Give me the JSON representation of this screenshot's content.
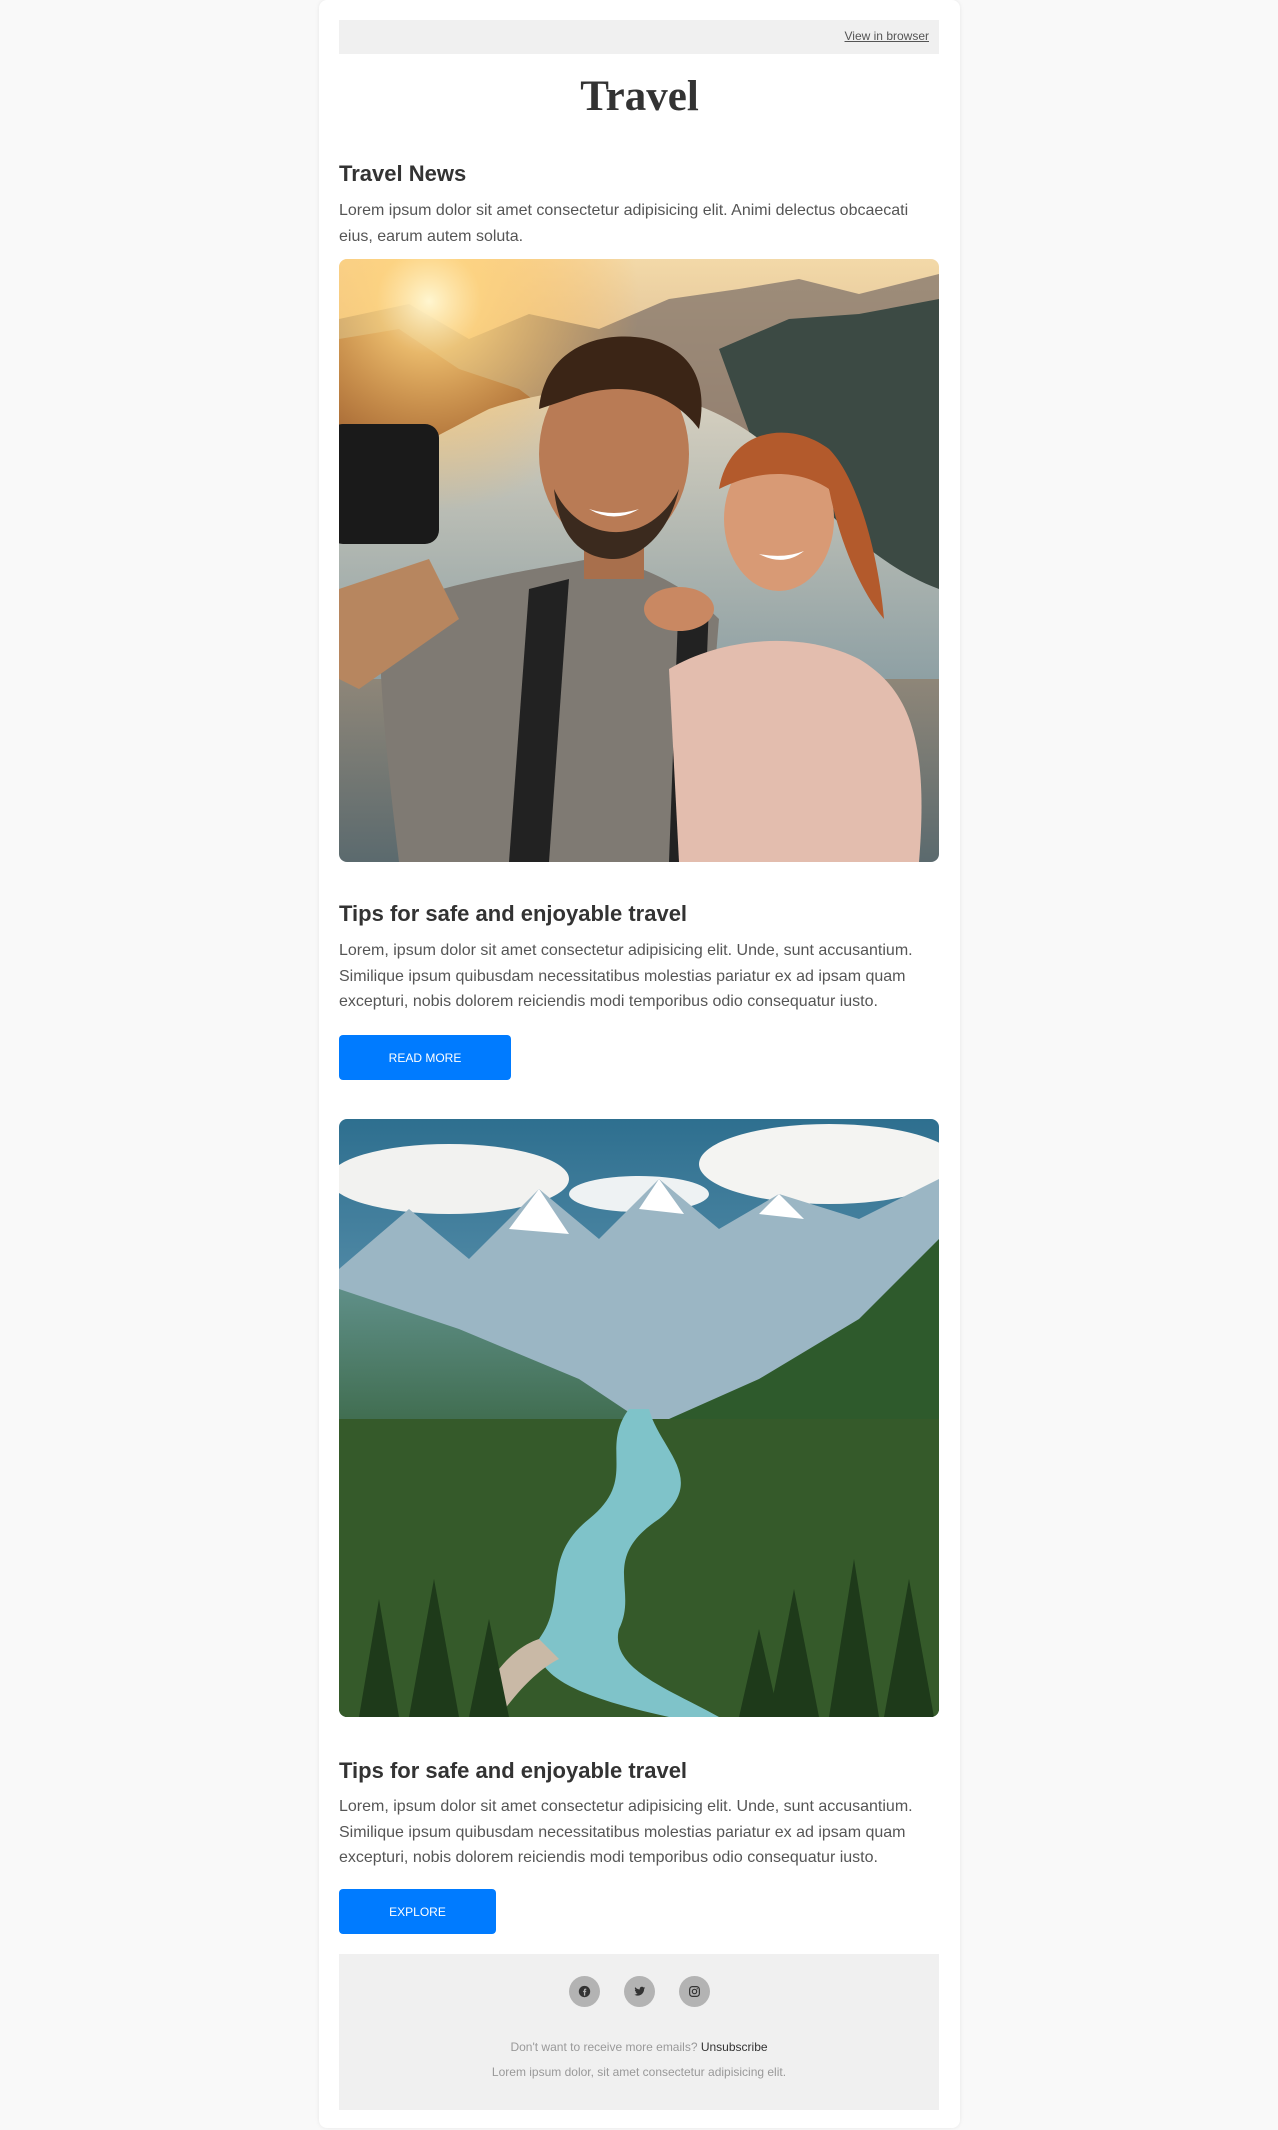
{
  "header": {
    "view_in_browser": "View in browser",
    "brand": "Travel"
  },
  "news": {
    "title": "Travel News",
    "text": "Lorem ipsum dolor sit amet consectetur adipisicing elit. Animi delectus obcaecati eius, earum autem soluta."
  },
  "article1": {
    "title": "Tips for safe and enjoyable travel",
    "text": "Lorem, ipsum dolor sit amet consectetur adipisicing elit. Unde, sunt accusantium. Similique ipsum quibusdam necessitatibus molestias pariatur ex ad ipsam quam excepturi, nobis dolorem reiciendis modi temporibus odio consequatur iusto.",
    "button": "READ MORE"
  },
  "article2": {
    "title": "Tips for safe and enjoyable travel",
    "text": "Lorem, ipsum dolor sit amet consectetur adipisicing elit. Unde, sunt accusantium. Similique ipsum quibusdam necessitatibus molestias pariatur ex ad ipsam quam excepturi, nobis dolorem reiciendis modi temporibus odio consequatur iusto.",
    "button": "EXPLORE"
  },
  "footer": {
    "socials": [
      "facebook-icon",
      "twitter-icon",
      "instagram-icon"
    ],
    "unsubscribe_prompt": "Don't want to receive more emails?",
    "unsubscribe_link": "Unsubscribe",
    "note": "Lorem ipsum dolor, sit amet consectetur adipisicing elit."
  },
  "colors": {
    "accent": "#007bff",
    "page_bg": "#f9f9f9",
    "panel_bg": "#f0f0f0"
  }
}
